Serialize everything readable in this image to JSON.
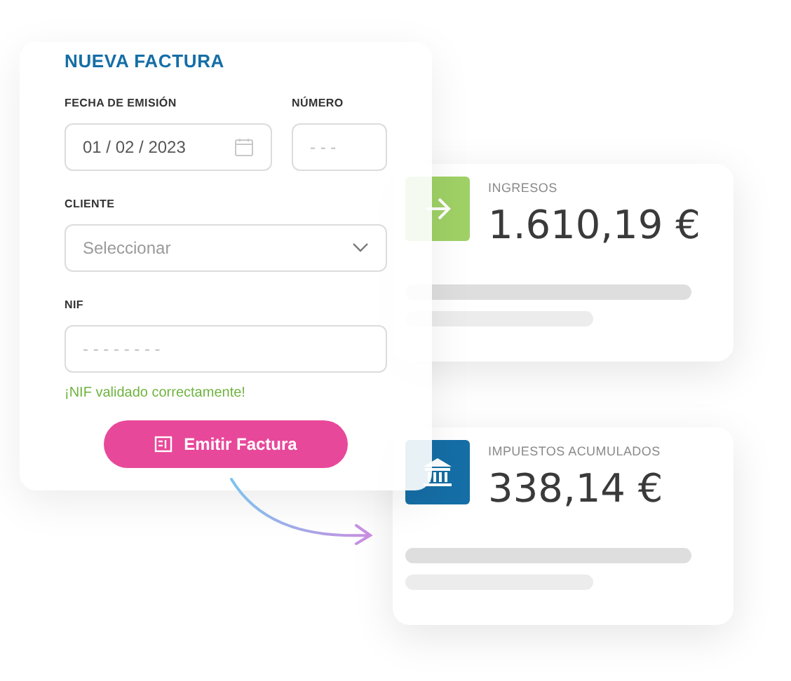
{
  "form": {
    "title": "NUEVA FACTURA",
    "rows": [
      [
        {
          "kind": "date",
          "label": "FECHA DE EMISIÓN",
          "value": "01 / 02 / 2023"
        },
        {
          "kind": "text",
          "label": "NÚMERO",
          "placeholder": "- - -"
        }
      ],
      [
        {
          "kind": "select",
          "label": "CLIENTE",
          "placeholder": "Seleccionar"
        }
      ],
      [
        {
          "kind": "text",
          "label": "NIF",
          "placeholder": "- - - - - - - -"
        }
      ]
    ],
    "validation": "¡NIF validado correctamente!",
    "button": "Emitir Factura"
  },
  "cards": [
    {
      "kind": "income",
      "label": "INGRESOS",
      "amount": "1.610,19 €",
      "color": "#9fd166"
    },
    {
      "kind": "tax",
      "label": "IMPUESTOS ACUMULADOS",
      "amount": "338,14 €",
      "color": "#156ea6"
    }
  ]
}
